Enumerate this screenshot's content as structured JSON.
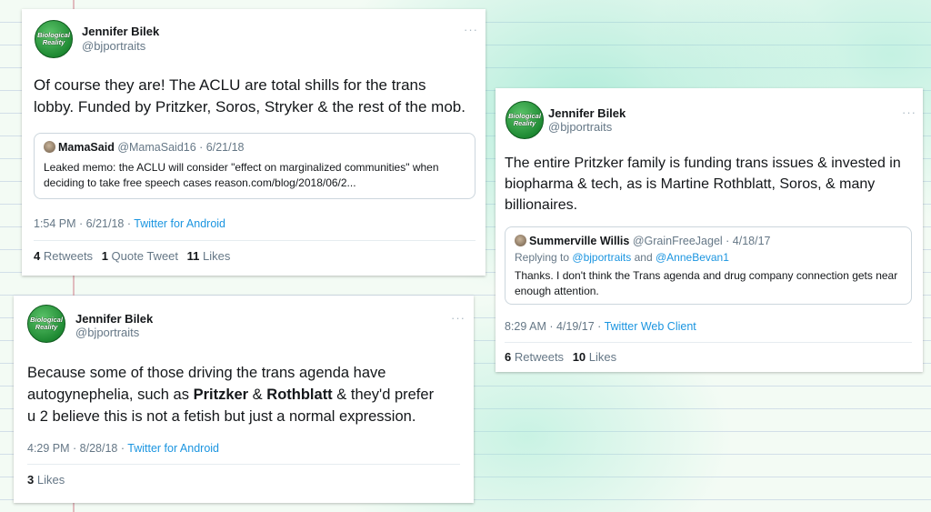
{
  "tweets": [
    {
      "author": {
        "name": "Jennifer Bilek",
        "handle": "@bjportraits",
        "avatar_text": [
          "Biological",
          "Reality"
        ]
      },
      "more": "···",
      "text": "Of course they are! The ACLU are total shills for the trans lobby. Funded by Pritzker, Soros, Stryker & the rest of the mob.",
      "quote": {
        "name": "MamaSaid",
        "handle": "@MamaSaid16 · 6/21/18",
        "text": "Leaked memo: the ACLU will consider \"effect on marginalized communities\" when deciding to take free speech cases reason.com/blog/2018/06/2..."
      },
      "time": "1:54 PM · 6/21/18",
      "source": "Twitter for Android",
      "stats": {
        "retweets_count": "4",
        "retweets_label": "Retweets",
        "quotes_count": "1",
        "quotes_label": "Quote Tweet",
        "likes_count": "11",
        "likes_label": "Likes"
      }
    },
    {
      "author": {
        "name": "Jennifer Bilek",
        "handle": "@bjportraits",
        "avatar_text": [
          "Biological",
          "Reality"
        ]
      },
      "more": "···",
      "text": "The entire Pritzker family is funding trans issues & invested in biopharma & tech, as is Martine Rothblatt, Soros, & many billionaires.",
      "quote": {
        "name": "Summerville Willis",
        "handle": "@GrainFreeJagel · 4/18/17",
        "reply_prefix": "Replying to",
        "reply_user1": "@bjportraits",
        "reply_and": "and",
        "reply_user2": "@AnneBevan1",
        "text": "Thanks. I don't think the Trans agenda and drug company connection gets near enough attention."
      },
      "time": "8:29 AM · 4/19/17",
      "source": "Twitter Web Client",
      "stats": {
        "retweets_count": "6",
        "retweets_label": "Retweets",
        "likes_count": "10",
        "likes_label": "Likes"
      }
    },
    {
      "author": {
        "name": "Jennifer Bilek",
        "handle": "@bjportraits",
        "avatar_text": [
          "Biological",
          "Reality"
        ]
      },
      "more": "···",
      "text_parts": [
        "Because some of those driving the trans agenda have autogynephelia, such as ",
        "Pritzker",
        " & ",
        "Rothblatt",
        " & they'd prefer u 2 believe this is not a fetish but just a normal expression."
      ],
      "time": "4:29 PM · 8/28/18",
      "source": "Twitter for Android",
      "stats": {
        "likes_count": "3",
        "likes_label": "Likes"
      }
    }
  ]
}
